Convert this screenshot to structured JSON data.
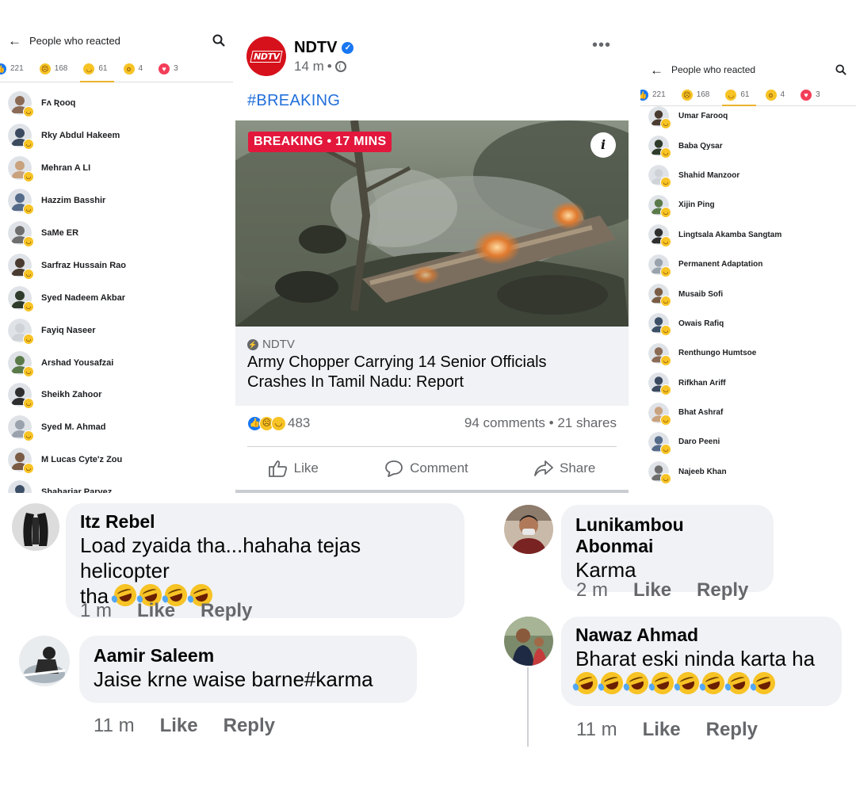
{
  "left_panel": {
    "title": "People who reacted",
    "tabs": [
      {
        "count": "221",
        "reaction": "like"
      },
      {
        "count": "168",
        "reaction": "sad"
      },
      {
        "count": "61",
        "reaction": "haha",
        "active": true
      },
      {
        "count": "4",
        "reaction": "wow"
      },
      {
        "count": "3",
        "reaction": "love"
      }
    ],
    "people": [
      "Fʌ Ʀooq",
      "Rky Abdul Hakeem",
      "Mehran A LI",
      "Hazzim Basshir",
      "SaMe ER",
      "Sarfraz Hussain Rao",
      "Syed Nadeem Akbar",
      "Fayiq Naseer",
      "Arshad Yousafzai",
      "Sheikh Zahoor",
      "Syed M. Ahmad",
      "M Lucas Cyte'z Zou",
      "Shahariar Parvez"
    ]
  },
  "right_panel": {
    "title": "People who reacted",
    "tabs": [
      {
        "count": "221",
        "reaction": "like"
      },
      {
        "count": "168",
        "reaction": "sad"
      },
      {
        "count": "61",
        "reaction": "haha",
        "active": true
      },
      {
        "count": "4",
        "reaction": "wow"
      },
      {
        "count": "3",
        "reaction": "love"
      }
    ],
    "people": [
      "Umar Farooq",
      "Baba Qysar",
      "Shahid Manzoor",
      "Xijin Ping",
      "Lingtsala Akamba Sangtam",
      "Permanent Adaptation",
      "Musaib Sofi",
      "Owais Rafiq",
      "Renthungo Humtsoe",
      "Rifkhan Ariff",
      "Bhat Ashraf",
      "Daro Peeni",
      "Najeeb Khan"
    ]
  },
  "post": {
    "page_name": "NDTV",
    "logo_text": "NDTV",
    "time": "14 m",
    "more_icon": "•••",
    "hashtag": "#BREAKING",
    "image_tag": "BREAKING • 17 MINS",
    "info_icon": "i",
    "link_source": "NDTV",
    "link_title_line1": "Army Chopper Carrying 14 Senior Officials",
    "link_title_line2": "Crashes In Tamil Nadu: Report",
    "reaction_count": "483",
    "comments_shares": "94 comments • 21 shares",
    "actions": {
      "like": "Like",
      "comment": "Comment",
      "share": "Share"
    }
  },
  "comments": [
    {
      "name": "Itz Rebel",
      "text_line1": "Load zyaida tha...hahaha tejas helicopter",
      "text_line2": "tha",
      "laughs": 4,
      "time": "1 m",
      "like": "Like",
      "reply": "Reply"
    },
    {
      "name": "Aamir Saleem",
      "text_line1": "Jaise krne waise barne#karma",
      "time": "11 m",
      "like": "Like",
      "reply": "Reply"
    },
    {
      "name": "Lunikambou Abonmai",
      "text_line1": "Karma",
      "time": "2 m",
      "like": "Like",
      "reply": "Reply"
    },
    {
      "name": "Nawaz Ahmad",
      "text_line1": "Bharat eski ninda karta ha",
      "laughs": 8,
      "time": "11 m",
      "like": "Like",
      "reply": "Reply"
    }
  ],
  "colors": {
    "ndtv_red": "#d6111b",
    "breaking_red": "#e3173c",
    "fb_blue": "#1877f2",
    "haha_yellow": "#f7c325",
    "hashtag_blue": "#216fdb"
  }
}
